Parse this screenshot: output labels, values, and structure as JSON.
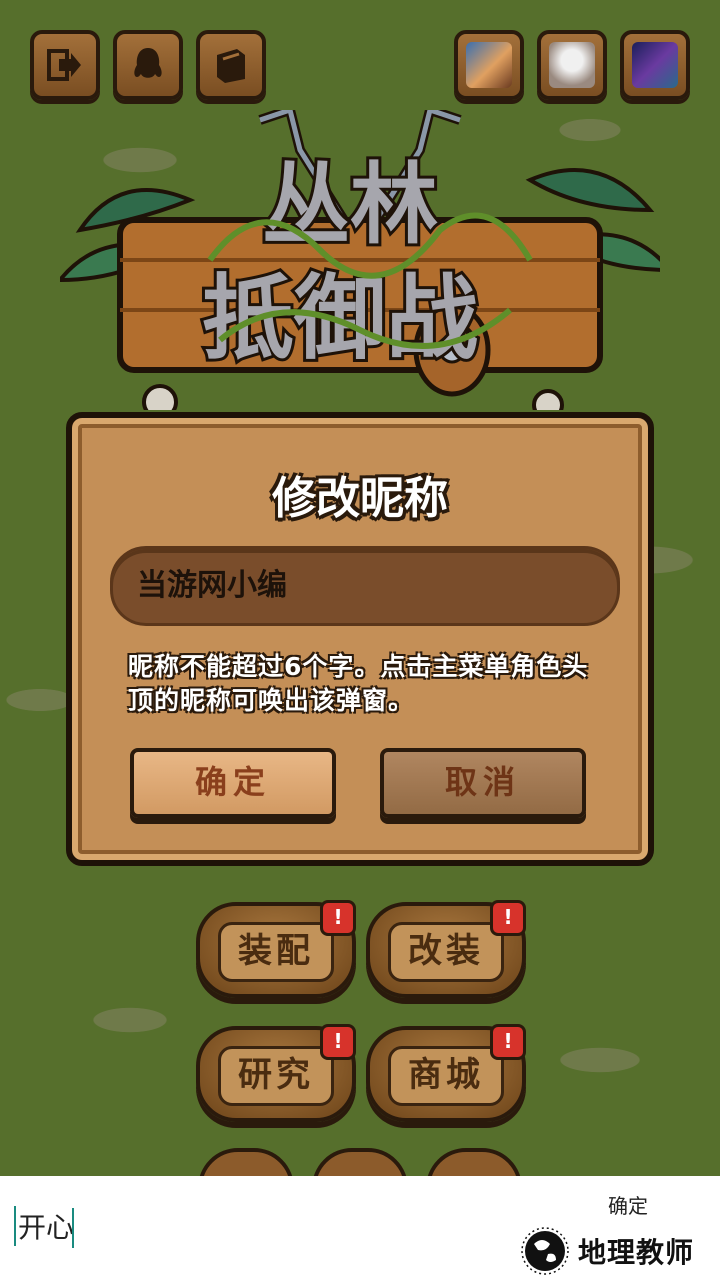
{
  "top_bar": {
    "left_icons": [
      "exit-icon",
      "qq-penguin-icon",
      "book-icon"
    ],
    "right_thumbs": [
      "game-thumb-1-icon",
      "game-thumb-2-icon",
      "game-thumb-3-icon"
    ]
  },
  "logo": {
    "text_line1": "丛林",
    "text_line2": "抵御战"
  },
  "dialog": {
    "title": "修改昵称",
    "nickname_value": "当游网小编",
    "hint": "昵称不能超过6个字。点击主菜单角色头顶的昵称可唤出该弹窗。",
    "confirm_label": "确定",
    "cancel_label": "取消"
  },
  "menu": {
    "equip_label": "装配",
    "modify_label": "改装",
    "research_label": "研究",
    "shop_label": "商城",
    "badge": "!"
  },
  "keyboard_bar": {
    "input_value": "开心",
    "confirm_label": "确定",
    "watermark": "地理教师"
  },
  "colors": {
    "dialog_bg": "#c48f57",
    "grass": "#566f2c",
    "cancel_text": "#6e3416",
    "confirm_text": "#8a3f1c"
  }
}
